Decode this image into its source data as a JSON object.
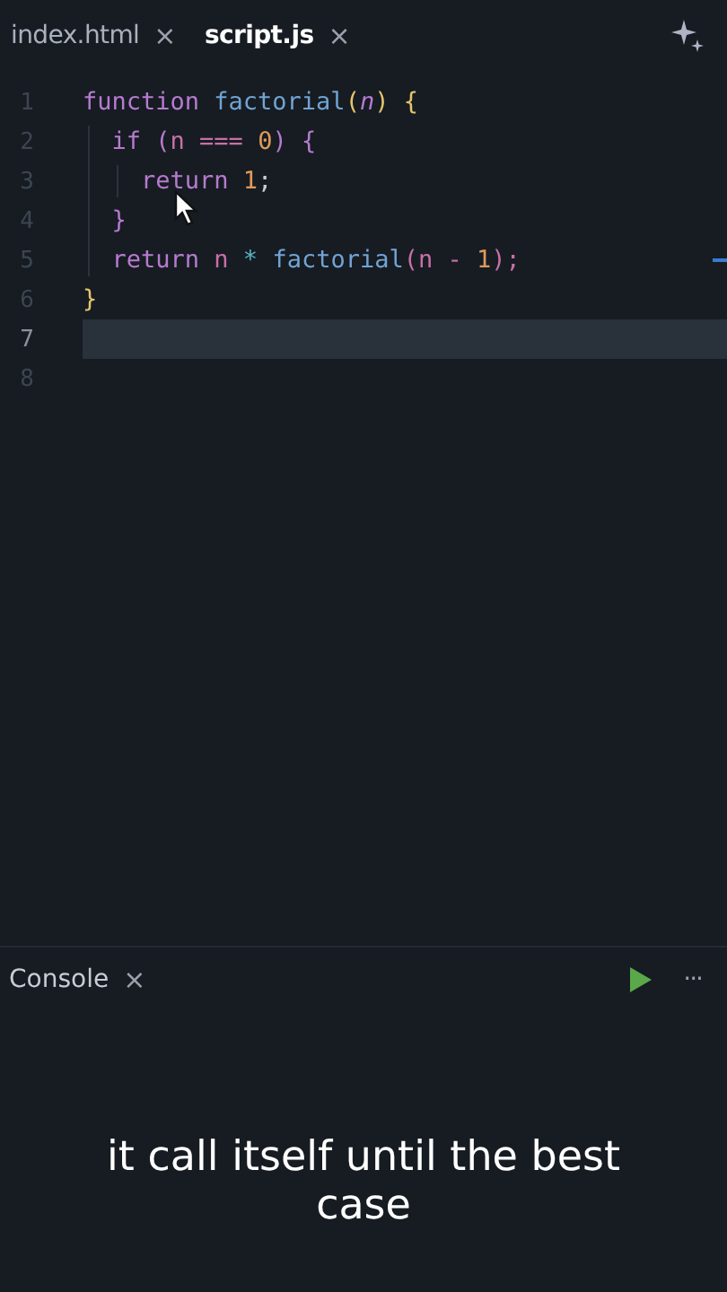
{
  "tabs": [
    {
      "label": "index.html",
      "close": "×",
      "selected": false
    },
    {
      "label": "script.js",
      "close": "×",
      "selected": true
    }
  ],
  "editor": {
    "lines": [
      {
        "number": "1",
        "current": false,
        "tokens": [
          {
            "kind": "keyword",
            "text": "function "
          },
          {
            "kind": "function",
            "text": "factorial"
          },
          {
            "kind": "bracket",
            "text": "("
          },
          {
            "kind": "param",
            "text": "n"
          },
          {
            "kind": "bracket",
            "text": ") {"
          }
        ]
      },
      {
        "number": "2",
        "current": false,
        "tokens": [
          {
            "kind": "keyword",
            "text": "  if ("
          },
          {
            "kind": "variable",
            "text": "n === "
          },
          {
            "kind": "number",
            "text": "0"
          },
          {
            "kind": "keyword",
            "text": ") {"
          }
        ]
      },
      {
        "number": "3",
        "current": false,
        "tokens": [
          {
            "kind": "keyword",
            "text": "    return "
          },
          {
            "kind": "number",
            "text": "1"
          },
          {
            "kind": "plain",
            "text": ";"
          }
        ]
      },
      {
        "number": "4",
        "current": false,
        "tokens": [
          {
            "kind": "keyword",
            "text": "  }"
          }
        ]
      },
      {
        "number": "5",
        "current": false,
        "tokens": [
          {
            "kind": "keyword",
            "text": "  return "
          },
          {
            "kind": "variable",
            "text": "n "
          },
          {
            "kind": "operator",
            "text": "* "
          },
          {
            "kind": "function",
            "text": "factorial"
          },
          {
            "kind": "variable",
            "text": "(n - "
          },
          {
            "kind": "number",
            "text": "1"
          },
          {
            "kind": "variable",
            "text": ");"
          }
        ]
      },
      {
        "number": "6",
        "current": false,
        "tokens": [
          {
            "kind": "bracket",
            "text": "}"
          }
        ]
      },
      {
        "number": "7",
        "current": true
      },
      {
        "number": "8",
        "current": false
      }
    ]
  },
  "console": {
    "title": "Console",
    "close": "×",
    "more": "···"
  },
  "caption": "it call itself until the best case"
}
